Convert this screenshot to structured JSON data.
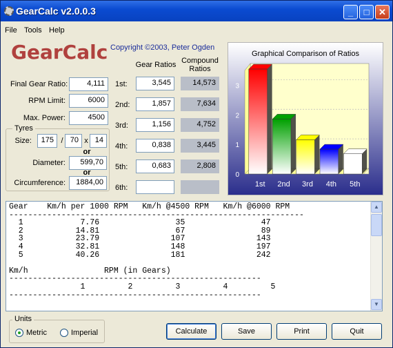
{
  "window": {
    "title": "GearCalc  v2.0.0.3",
    "controls": {
      "minimize": "_",
      "maximize": "□",
      "close": "✕"
    }
  },
  "menu": [
    "File",
    "Tools",
    "Help"
  ],
  "header": {
    "logo": "GearCalc",
    "copyright": "Copyright ©2003, Peter Ogden"
  },
  "inputs": {
    "final_gear_ratio": {
      "label": "Final Gear Ratio:",
      "value": "4,111"
    },
    "rpm_limit": {
      "label": "RPM Limit:",
      "value": "6000"
    },
    "max_power": {
      "label": "Max. Power:",
      "value": "4500"
    }
  },
  "tyres": {
    "group_label": "Tyres",
    "size_label": "Size:",
    "width": "175",
    "sep1": "/",
    "profile": "70",
    "sep2": "x",
    "rim": "14",
    "or1": "or",
    "diameter_label": "Diameter:",
    "diameter": "599,70",
    "or2": "or",
    "circumference_label": "Circumference:",
    "circumference": "1884,00"
  },
  "gears": {
    "ratio_header": "Gear Ratios",
    "compound_header": "Compound Ratios",
    "rows": [
      {
        "label": "1st:",
        "ratio": "3,545",
        "compound": "14,573"
      },
      {
        "label": "2nd:",
        "ratio": "1,857",
        "compound": "7,634"
      },
      {
        "label": "3rd:",
        "ratio": "1,156",
        "compound": "4,752"
      },
      {
        "label": "4th:",
        "ratio": "0,838",
        "compound": "3,445"
      },
      {
        "label": "5th:",
        "ratio": "0,683",
        "compound": "2,808"
      },
      {
        "label": "6th:",
        "ratio": "",
        "compound": ""
      }
    ]
  },
  "chart_data": {
    "type": "bar",
    "title": "Graphical Comparison of Ratios",
    "categories": [
      "1st",
      "2nd",
      "3rd",
      "4th",
      "5th"
    ],
    "values": [
      3.545,
      1.857,
      1.156,
      0.838,
      0.683
    ],
    "ylim": [
      0,
      3.5
    ],
    "yticks": [
      "0",
      "1",
      "2",
      "3"
    ],
    "colors": [
      "#ff0000",
      "#00a000",
      "#ffff00",
      "#0000ff",
      "#ffffff"
    ],
    "grid": true,
    "xlabel": "",
    "ylabel": ""
  },
  "output": {
    "lines": [
      "Gear    Km/h per 1000 RPM   Km/h @4500 RPM   Km/h @6000 RPM",
      "--------------------------------------------------------------",
      "  1            7.76                35                47",
      "  2           14.81                67                89",
      "  3           23.79               107               143",
      "  4           32.81               148               197",
      "  5           40.26               181               242",
      "",
      "Km/h                RPM (in Gears)",
      "-----------------------------------------------------",
      "               1         2         3         4         5",
      "-----------------------------------------------------"
    ]
  },
  "units": {
    "group_label": "Units",
    "metric": "Metric",
    "imperial": "Imperial",
    "selected": "Metric"
  },
  "buttons": {
    "calculate": "Calculate",
    "save": "Save",
    "print": "Print",
    "quit": "Quit"
  }
}
